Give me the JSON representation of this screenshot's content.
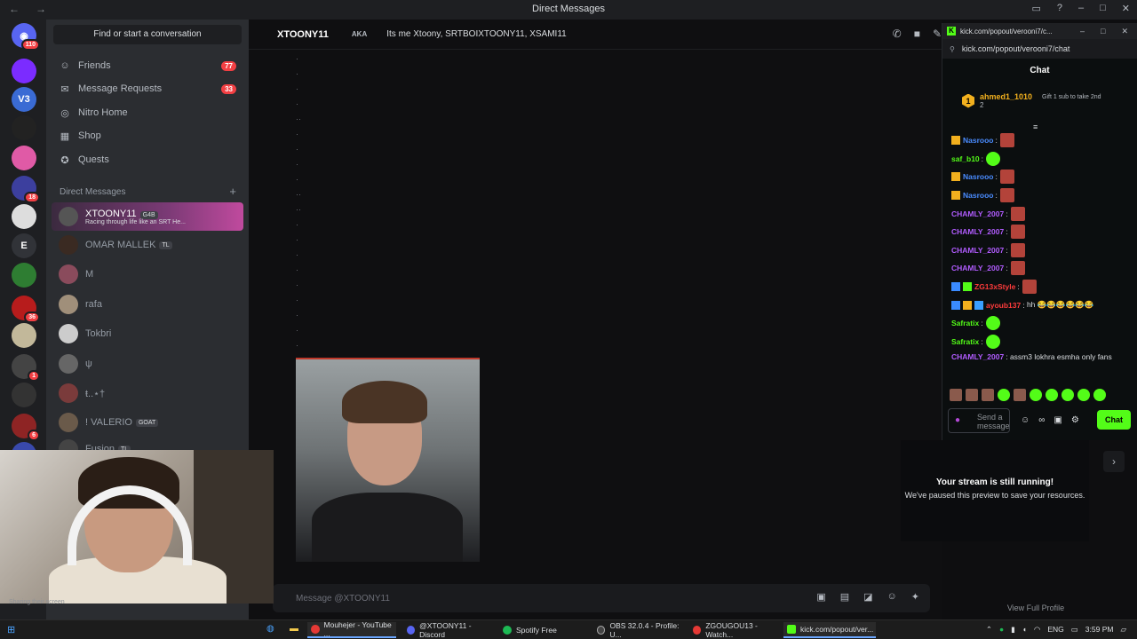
{
  "window": {
    "title": "Direct Messages"
  },
  "sidebar": {
    "search_label": "Find or start a conversation",
    "nav": [
      {
        "label": "Friends",
        "count": "77",
        "icon": "friends-icon"
      },
      {
        "label": "Message Requests",
        "count": "33",
        "icon": "envelope-icon"
      },
      {
        "label": "Nitro Home",
        "count": "",
        "icon": "nitro-icon"
      },
      {
        "label": "Shop",
        "count": "",
        "icon": "shop-icon"
      },
      {
        "label": "Quests",
        "count": "",
        "icon": "quests-icon"
      }
    ],
    "dm_header": "Direct Messages",
    "dms": [
      {
        "name": "XTOONY11",
        "tag": "G4B",
        "sub": "Racing through life like an SRT He..."
      },
      {
        "name": "OMAR MALLEK",
        "tag": "TL",
        "sub": ""
      },
      {
        "name": "M",
        "tag": "",
        "sub": ""
      },
      {
        "name": "rafa",
        "tag": "",
        "sub": ""
      },
      {
        "name": "Tokbri",
        "tag": "",
        "sub": ""
      },
      {
        "name": "ψ",
        "tag": "",
        "sub": ""
      },
      {
        "name": "ŧ..⋆†",
        "tag": "",
        "sub": ""
      },
      {
        "name": "! VALERIO",
        "tag": "GOAT",
        "sub": ""
      },
      {
        "name": "Fusion",
        "tag": "TL",
        "sub": ""
      }
    ]
  },
  "servers": [
    {
      "label": "",
      "badge": "110"
    },
    {
      "label": "",
      "badge": ""
    },
    {
      "label": "V3",
      "badge": ""
    },
    {
      "label": "",
      "badge": ""
    },
    {
      "label": "",
      "badge": ""
    },
    {
      "label": "",
      "badge": "18"
    },
    {
      "label": "",
      "badge": ""
    },
    {
      "label": "E",
      "badge": ""
    },
    {
      "label": "",
      "badge": ""
    },
    {
      "label": "",
      "badge": "36"
    },
    {
      "label": "",
      "badge": ""
    },
    {
      "label": "",
      "badge": "1"
    },
    {
      "label": "",
      "badge": ""
    },
    {
      "label": "",
      "badge": "6"
    },
    {
      "label": "",
      "badge": ""
    }
  ],
  "chat": {
    "name": "XTOONY11",
    "aka_label": "AKA",
    "aka_text": "Its me Xtoony, SRTBOIXTOONY11, XSAMI11",
    "composer_placeholder": "Message @XTOONY11",
    "sharing_text": "Sharing their screen"
  },
  "kick": {
    "window_title": "kick.com/popout/verooni7/c...",
    "url": "kick.com/popout/verooni7/chat",
    "chat_title": "Chat",
    "pinned_user": "ahmed1_1010",
    "pinned_rank": "1",
    "pinned_count": "2",
    "gift_text": "Gift 1 sub to take 2nd",
    "messages": [
      {
        "user": "Nasrooo",
        "color": "#4a8cff",
        "text": "",
        "emote": "red"
      },
      {
        "user": "saf_b10",
        "color": "#53fc18",
        "text": "",
        "emote": "green"
      },
      {
        "user": "Nasrooo",
        "color": "#4a8cff",
        "text": "",
        "emote": "red"
      },
      {
        "user": "Nasrooo",
        "color": "#4a8cff",
        "text": "",
        "emote": "red"
      },
      {
        "user": "CHAMLY_2007",
        "color": "#b15cff",
        "text": "",
        "emote": "red"
      },
      {
        "user": "CHAMLY_2007",
        "color": "#b15cff",
        "text": "",
        "emote": "red"
      },
      {
        "user": "CHAMLY_2007",
        "color": "#b15cff",
        "text": "",
        "emote": "red"
      },
      {
        "user": "CHAMLY_2007",
        "color": "#b15cff",
        "text": "",
        "emote": "red"
      },
      {
        "user": "ZG13xStyle",
        "color": "#ff3b3b",
        "text": "",
        "emote": "red"
      },
      {
        "user": "ayoub137",
        "color": "#ff3b3b",
        "text": "hh 😂😂😂😂😂😂",
        "emote": ""
      },
      {
        "user": "Safratix",
        "color": "#53fc18",
        "text": "",
        "emote": "green"
      },
      {
        "user": "Safratix",
        "color": "#53fc18",
        "text": "",
        "emote": "green"
      }
    ],
    "last_message": {
      "user": "CHAMLY_2007",
      "color": "#b15cff",
      "text": "assm3 lokhra esmha only fans"
    },
    "input_placeholder": "Send a message",
    "send_label": "Chat"
  },
  "stream_card": {
    "title": "Your stream is still running!",
    "subtitle": "We've paused this preview to save your resources."
  },
  "profile_link": "View Full Profile",
  "taskbar": {
    "tasks": [
      {
        "label": "Mouhejer - YouTube ...",
        "color": "#e53935"
      },
      {
        "label": "@XTOONY11 - Discord",
        "color": "#5865f2"
      },
      {
        "label": "Spotify Free",
        "color": "#1db954"
      },
      {
        "label": "OBS 32.0.4 - Profile: U...",
        "color": "#444444"
      },
      {
        "label": "ZGOUGOU13 - Watch...",
        "color": "#e53935"
      },
      {
        "label": "kick.com/popout/ver...",
        "color": "#53fc18"
      }
    ],
    "lang": "ENG",
    "time": "3:59 PM"
  }
}
